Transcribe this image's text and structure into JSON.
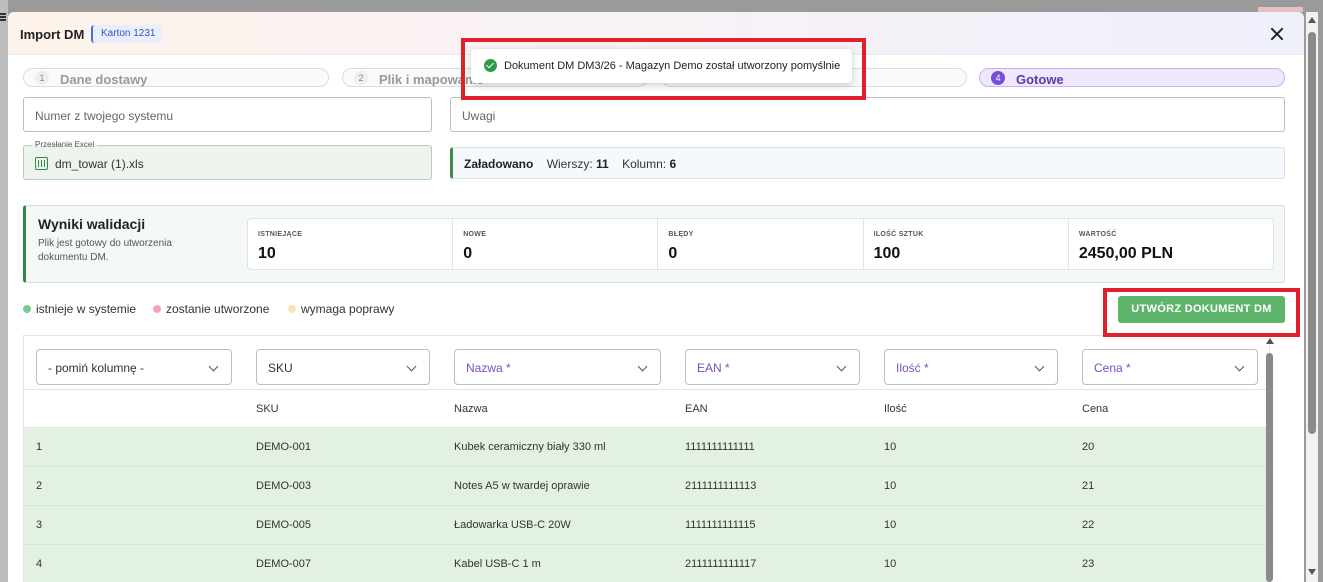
{
  "modal": {
    "title": "Import DM",
    "badge": "Karton 1231"
  },
  "steps": [
    {
      "num": "1",
      "label": "Dane dostawy",
      "active": false
    },
    {
      "num": "2",
      "label": "Plik i mapowanie",
      "active": false
    },
    {
      "num": "4",
      "label": "Gotowe",
      "active": true
    }
  ],
  "toast": {
    "message": "Dokument DM DM3/26 - Magazyn Demo został utworzony pomyślnie"
  },
  "fields": {
    "external_number_placeholder": "Numer z twojego systemu",
    "notes_placeholder": "Uwagi",
    "excel_legend": "Przesłanie Excel",
    "excel_filename": "dm_towar (1).xls"
  },
  "loaded": {
    "label": "Załadowano",
    "rows_label": "Wierszy:",
    "rows": "11",
    "cols_label": "Kolumn:",
    "cols": "6"
  },
  "validation": {
    "title": "Wyniki walidacji",
    "subtitle": "Plik jest gotowy do utworzenia dokumentu DM.",
    "stats": [
      {
        "label": "ISTNIEJĄCE",
        "value": "10"
      },
      {
        "label": "NOWE",
        "value": "0"
      },
      {
        "label": "BŁĘDY",
        "value": "0"
      },
      {
        "label": "ILOŚĆ SZTUK",
        "value": "100"
      },
      {
        "label": "WARTOŚĆ",
        "value": "2450,00 PLN"
      }
    ]
  },
  "legend": [
    {
      "label": "istnieje w systemie",
      "color": "#7fc78a"
    },
    {
      "label": "zostanie utworzone",
      "color": "#f0a6bf"
    },
    {
      "label": "wymaga poprawy",
      "color": "#f7e6b6"
    }
  ],
  "actions": {
    "create": "UTWÓRZ DOKUMENT DM"
  },
  "mapping": [
    "- pomiń kolumnę -",
    "SKU",
    "Nazwa *",
    "EAN *",
    "Ilość *",
    "Cena *"
  ],
  "table": {
    "headers": [
      "",
      "SKU",
      "Nazwa",
      "EAN",
      "Ilość",
      "Cena"
    ],
    "rows": [
      [
        "1",
        "DEMO-001",
        "Kubek ceramiczny biały 330 ml",
        "1111111111111",
        "10",
        "20"
      ],
      [
        "2",
        "DEMO-003",
        "Notes A5 w twardej oprawie",
        "2111111111113",
        "10",
        "21"
      ],
      [
        "3",
        "DEMO-005",
        "Ładowarka USB-C 20W",
        "1111111111115",
        "10",
        "22"
      ],
      [
        "4",
        "DEMO-007",
        "Kabel USB-C 1 m",
        "2111111111117",
        "10",
        "23"
      ]
    ]
  },
  "colors": {
    "accent": "#7b4cd8",
    "success": "#5fb46b",
    "highlight": "#e0202a"
  }
}
